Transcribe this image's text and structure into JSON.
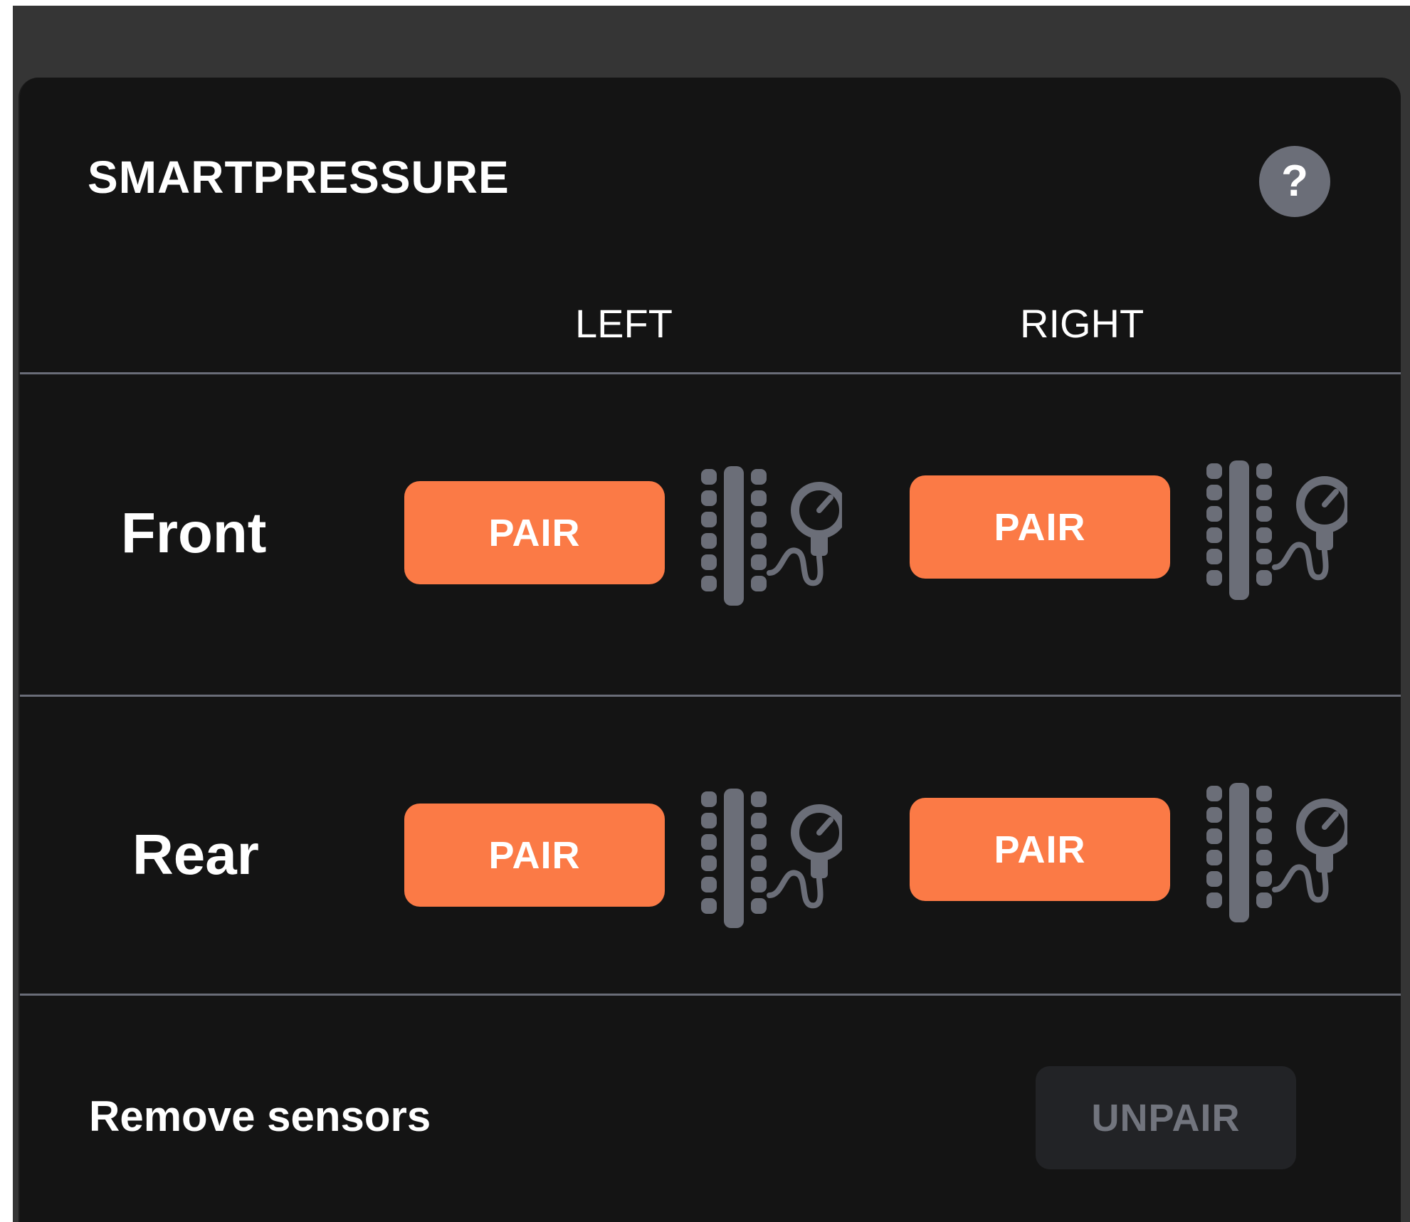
{
  "panel": {
    "title": "SMARTPRESSURE",
    "help_label": "?"
  },
  "columns": {
    "left": "LEFT",
    "right": "RIGHT"
  },
  "rows": {
    "front": {
      "label": "Front",
      "left_button": "PAIR",
      "right_button": "PAIR"
    },
    "rear": {
      "label": "Rear",
      "left_button": "PAIR",
      "right_button": "PAIR"
    }
  },
  "remove": {
    "label": "Remove sensors",
    "button": "UNPAIR"
  },
  "colors": {
    "accent": "#fb7a46",
    "panel_background": "#141414",
    "header_background": "#353535",
    "icon": "#6b6e78",
    "disabled_text": "#72757e"
  },
  "icons": {
    "help": "question-mark-icon",
    "tire_sensor": "tire-pressure-gauge-icon"
  }
}
